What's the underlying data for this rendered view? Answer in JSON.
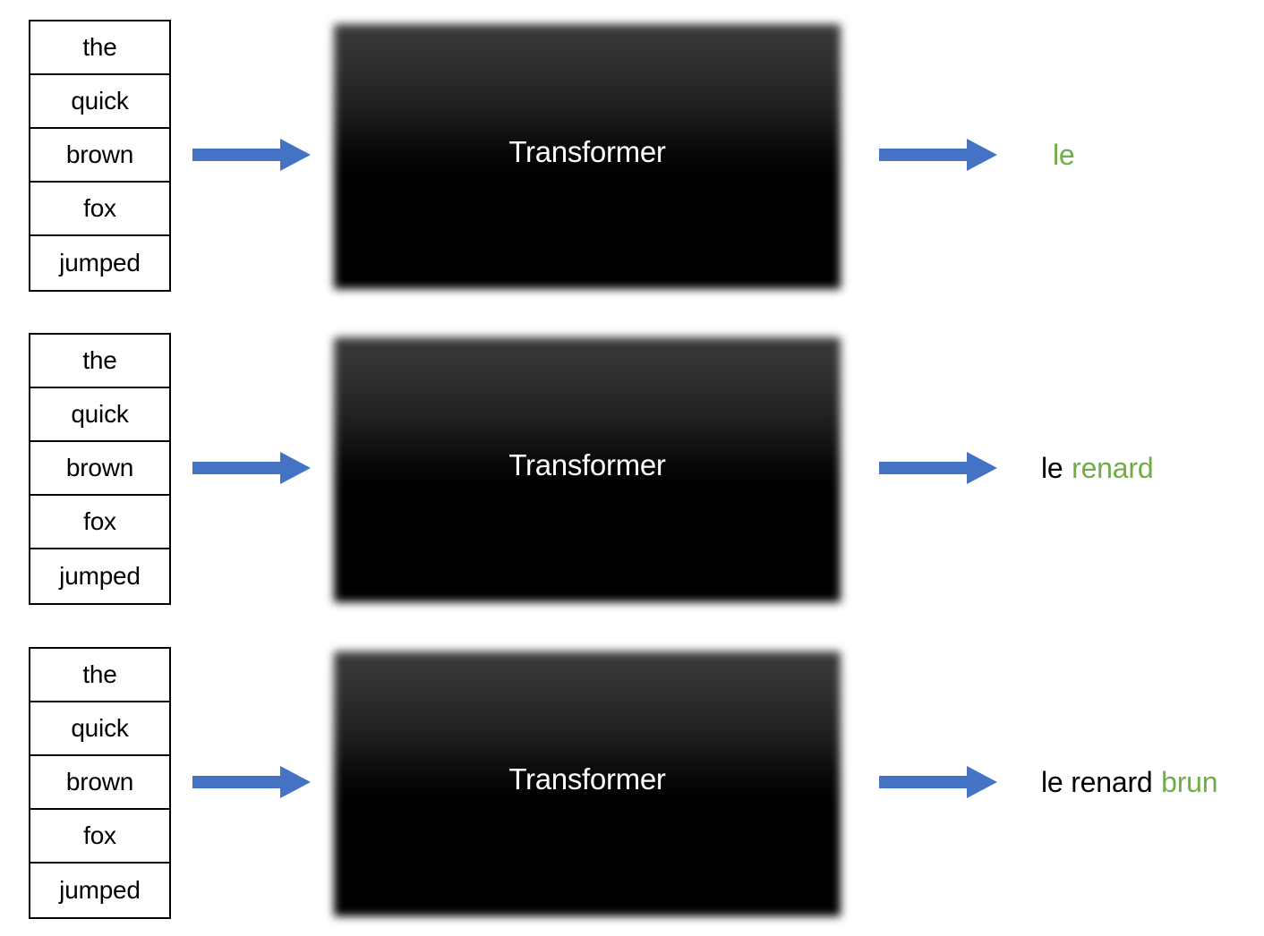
{
  "colors": {
    "arrow_blue": "#4472C4",
    "new_token_green": "#70AD47",
    "previous_token_black": "#000000",
    "block_background": "#000000",
    "table_border": "#000000",
    "page_background": "#ffffff"
  },
  "icons": {
    "arrow_in": "right-arrow-icon",
    "arrow_out": "right-arrow-icon"
  },
  "model": {
    "block_label": "Transformer"
  },
  "source_tokens": [
    "the",
    "quick",
    "brown",
    "fox",
    "jumped"
  ],
  "steps": [
    {
      "index": 1,
      "input_tokens": [
        "the",
        "quick",
        "brown",
        "fox",
        "jumped"
      ],
      "block_label": "Transformer",
      "output_full": "le",
      "output_previous": "",
      "output_new": "le"
    },
    {
      "index": 2,
      "input_tokens": [
        "the",
        "quick",
        "brown",
        "fox",
        "jumped"
      ],
      "block_label": "Transformer",
      "output_full": "le renard",
      "output_previous": "le",
      "output_new": "renard"
    },
    {
      "index": 3,
      "input_tokens": [
        "the",
        "quick",
        "brown",
        "fox",
        "jumped"
      ],
      "block_label": "Transformer",
      "output_full": "le renard brun",
      "output_previous": "le renard",
      "output_new": "brun"
    }
  ]
}
